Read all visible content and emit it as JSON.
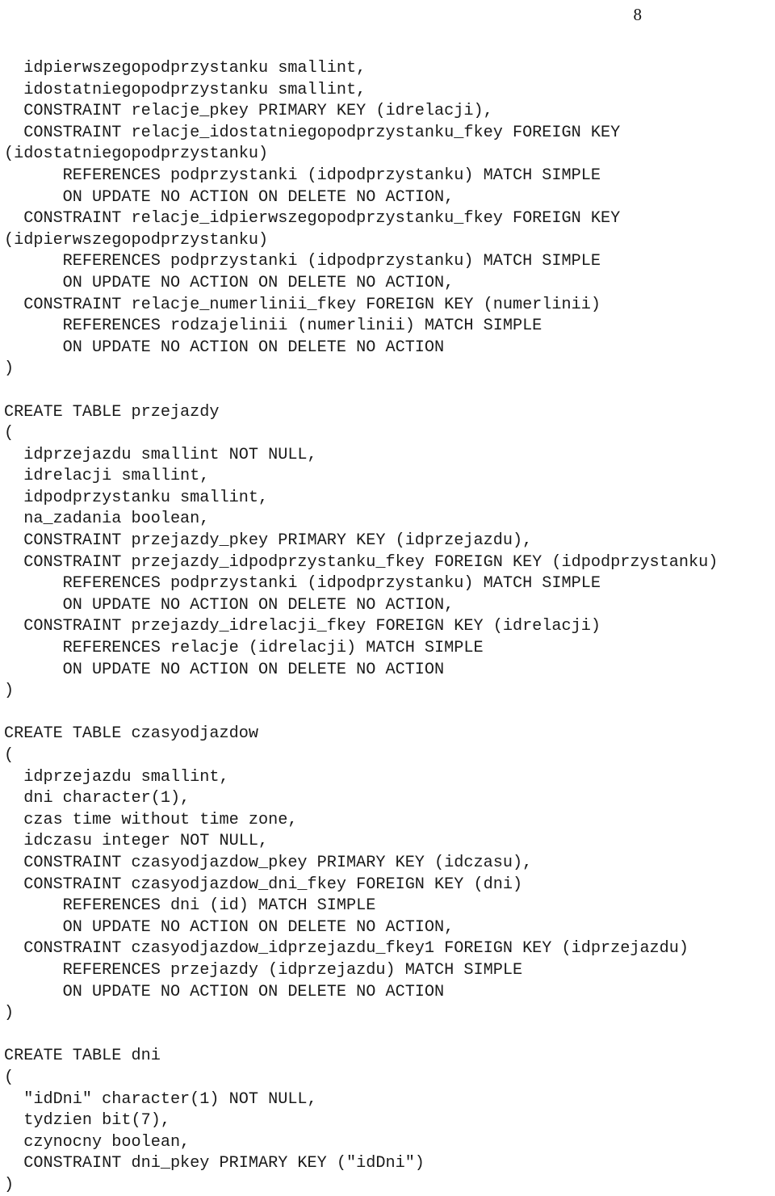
{
  "document": {
    "page_number": "8",
    "language": "sql",
    "code_lines": [
      "  idpierwszegopodprzystanku smallint,",
      "  idostatniegopodprzystanku smallint,",
      "  CONSTRAINT relacje_pkey PRIMARY KEY (idrelacji),",
      "  CONSTRAINT relacje_idostatniegopodprzystanku_fkey FOREIGN KEY",
      "(idostatniegopodprzystanku)",
      "      REFERENCES podprzystanki (idpodprzystanku) MATCH SIMPLE",
      "      ON UPDATE NO ACTION ON DELETE NO ACTION,",
      "  CONSTRAINT relacje_idpierwszegopodprzystanku_fkey FOREIGN KEY",
      "(idpierwszegopodprzystanku)",
      "      REFERENCES podprzystanki (idpodprzystanku) MATCH SIMPLE",
      "      ON UPDATE NO ACTION ON DELETE NO ACTION,",
      "  CONSTRAINT relacje_numerlinii_fkey FOREIGN KEY (numerlinii)",
      "      REFERENCES rodzajelinii (numerlinii) MATCH SIMPLE",
      "      ON UPDATE NO ACTION ON DELETE NO ACTION",
      ")",
      "",
      "CREATE TABLE przejazdy",
      "(",
      "  idprzejazdu smallint NOT NULL,",
      "  idrelacji smallint,",
      "  idpodprzystanku smallint,",
      "  na_zadania boolean,",
      "  CONSTRAINT przejazdy_pkey PRIMARY KEY (idprzejazdu),",
      "  CONSTRAINT przejazdy_idpodprzystanku_fkey FOREIGN KEY (idpodprzystanku)",
      "      REFERENCES podprzystanki (idpodprzystanku) MATCH SIMPLE",
      "      ON UPDATE NO ACTION ON DELETE NO ACTION,",
      "  CONSTRAINT przejazdy_idrelacji_fkey FOREIGN KEY (idrelacji)",
      "      REFERENCES relacje (idrelacji) MATCH SIMPLE",
      "      ON UPDATE NO ACTION ON DELETE NO ACTION",
      ")",
      "",
      "CREATE TABLE czasyodjazdow",
      "(",
      "  idprzejazdu smallint,",
      "  dni character(1),",
      "  czas time without time zone,",
      "  idczasu integer NOT NULL,",
      "  CONSTRAINT czasyodjazdow_pkey PRIMARY KEY (idczasu),",
      "  CONSTRAINT czasyodjazdow_dni_fkey FOREIGN KEY (dni)",
      "      REFERENCES dni (id) MATCH SIMPLE",
      "      ON UPDATE NO ACTION ON DELETE NO ACTION,",
      "  CONSTRAINT czasyodjazdow_idprzejazdu_fkey1 FOREIGN KEY (idprzejazdu)",
      "      REFERENCES przejazdy (idprzejazdu) MATCH SIMPLE",
      "      ON UPDATE NO ACTION ON DELETE NO ACTION",
      ")",
      "",
      "CREATE TABLE dni",
      "(",
      "  \"idDni\" character(1) NOT NULL,",
      "  tydzien bit(7),",
      "  czynocny boolean,",
      "  CONSTRAINT dni_pkey PRIMARY KEY (\"idDni\")",
      ")"
    ]
  }
}
